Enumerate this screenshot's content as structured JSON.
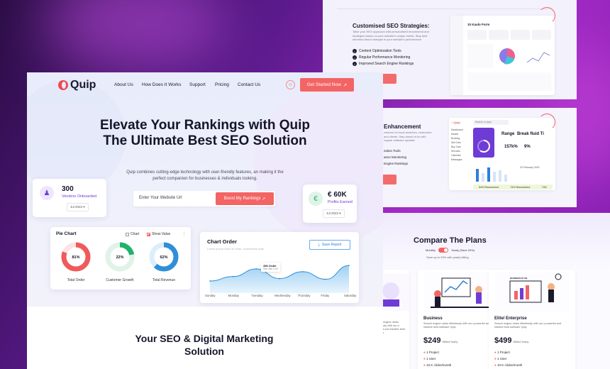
{
  "seo_panel": {
    "title": "Customised SEO Strategies:",
    "desc": "Tailor your SEO approach with personalised recommend and strategies based on your website's unique needs. Stay best informed about changes in your website's performance",
    "features": [
      "Content Optimization Tools",
      "Regular Performance Monitoring",
      "Improved Search Engine Rankings"
    ],
    "dash_title": "10 Kaulo Form"
  },
  "enh_panel": {
    "title": "Enhancement",
    "desc": "resence for local searches, customers and clients. Stay ahead of es with regular software updates",
    "features": [
      "zation Tools",
      "ance Monitoring",
      "Engine Rankings"
    ],
    "search_placeholder": "Search or type",
    "sidebar": [
      "Dashboard",
      "Assets",
      "Booking",
      "Sell Cars",
      "Buy Cars",
      "Services",
      "Calender",
      "Messages"
    ],
    "range": "Range",
    "breakfluid": "Break fluid Ti",
    "range_val": "157k%",
    "break_val": "9%",
    "bottom": [
      "64% Recommend",
      "74% Recommend",
      "74%"
    ],
    "date": "20 February 2022"
  },
  "plans": {
    "title": "Compare The Plans",
    "toggle_monthly": "Monthly",
    "toggle_yearly": "Yearly (Save 20%)",
    "save_note": "Save up to 20% with yearly billing",
    "cards": [
      {
        "name": "",
        "desc": "Search engine ranks effortlessly with our a powerful and intuitive best software",
        "features": []
      },
      {
        "name": "Business",
        "desc": "Search engine ranks effortlessly with our a powerful and intuitive best software Quip",
        "price": "$249",
        "period": "/Billed Yearly",
        "features": [
          "1 Project",
          "1 User",
          "10 K clicks/month"
        ]
      },
      {
        "name": "Elite/ Enterprise",
        "desc": "Search engine ranks effortlessly with our a powerful and intuitive best software Quip",
        "price": "$499",
        "period": "/Billed Yearly",
        "features": [
          "1 Project",
          "1 User",
          "10 K clicks/month"
        ]
      }
    ],
    "illustration_label": "BUSINESS PLAN"
  },
  "nav": {
    "brand": "Quip",
    "links": [
      "About Us",
      "How Does It Works",
      "Support",
      "Pricing",
      "Contact Us"
    ],
    "cta": "Get Started Now",
    "cta_arrow": "↗"
  },
  "hero": {
    "title": "Elevate Your Rankings with Quip The Ultimate Best SEO Solution",
    "subtitle": "Quip combines cutting-edge technology with user-friendly features, an making it the perfect companion for businesses & individuals looking.",
    "input_placeholder": "Enter Your Website Url",
    "button": "Boost My Rankings",
    "button_arrow": "↗"
  },
  "stats": {
    "vendors": {
      "value": "300",
      "label": "Vendors Onboarded",
      "period": "Jul 2022"
    },
    "profits": {
      "value": "€ 60K",
      "label": "Profits Earned",
      "period": "Jul 2022",
      "icon": "€"
    }
  },
  "pie_chart": {
    "title": "Pie Chart",
    "opt_chart": "Chart",
    "opt_show_value": "Show Value",
    "donuts": [
      {
        "label": "Total Order",
        "value": "81%",
        "pct": 81,
        "color": "#f05a5a",
        "track": "#fde3e3"
      },
      {
        "label": "Customer Growth",
        "value": "22%",
        "pct": 22,
        "color": "#20b26b",
        "track": "#dff3e8"
      },
      {
        "label": "Total Revenue",
        "value": "62%",
        "pct": 62,
        "color": "#2f8fd8",
        "track": "#dceefb"
      }
    ]
  },
  "chart_order": {
    "title": "Chart Order",
    "subtitle": "Lorem ipsum dolor sit amet, consectetur adip",
    "button": "Save Report",
    "tooltip_value": "456 Order",
    "tooltip_sub": "Sen 456 2,42"
  },
  "chart_data": {
    "type": "area",
    "x": [
      "Sunday",
      "Monday",
      "Tuesday",
      "Wednesday",
      "Thursday",
      "Friday",
      "Saturday"
    ],
    "values": [
      35,
      48,
      70,
      42,
      62,
      40,
      80
    ]
  },
  "section2": {
    "title": "Your SEO & Digital Marketing Solution"
  }
}
